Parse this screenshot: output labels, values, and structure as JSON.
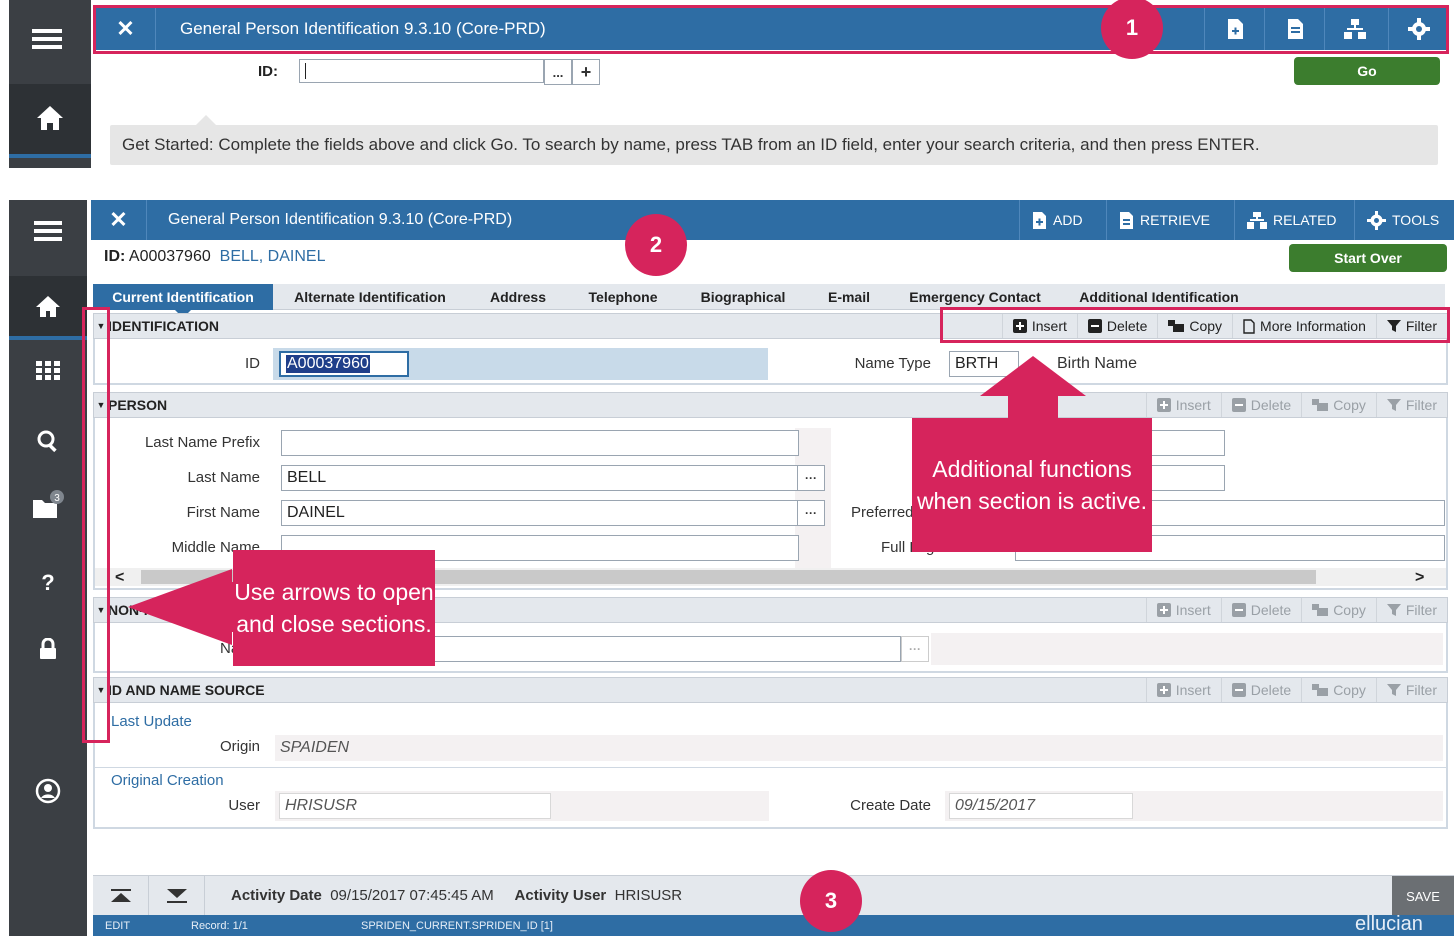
{
  "colors": {
    "nav_bar": "#2e6da4",
    "sidebar": "#3b3f44",
    "accent_annotation": "#d6245c",
    "go_button": "#3c7d2e",
    "link_text": "#2e6da4"
  },
  "screen1": {
    "title": "General Person Identification 9.3.10 (Core-PRD)",
    "close_icon": "✕",
    "toolbar_icons": [
      "add-icon",
      "retrieve-icon",
      "related-icon",
      "tools-icon"
    ],
    "id_label": "ID:",
    "id_value": "",
    "search_button": "...",
    "add_button": "+",
    "go_label": "Go",
    "tip": "Get Started: Complete the fields above and click Go. To search by name, press TAB from an ID field, enter your search criteria, and then press ENTER.",
    "badge": "1"
  },
  "screen2": {
    "title": "General Person Identification 9.3.10 (Core-PRD)",
    "actions": {
      "add": "ADD",
      "retrieve": "RETRIEVE",
      "related": "RELATED",
      "tools": "TOOLS"
    },
    "key_label": "ID:",
    "key_id": "A00037960",
    "key_name": "BELL, DAINEL",
    "start_over": "Start Over",
    "badge": "2",
    "tabs": [
      "Current Identification",
      "Alternate Identification",
      "Address",
      "Telephone",
      "Biographical",
      "E-mail",
      "Emergency Contact",
      "Additional Identification"
    ],
    "section_tools": {
      "insert": "Insert",
      "delete": "Delete",
      "copy": "Copy",
      "more": "More Information",
      "filter": "Filter"
    },
    "identification": {
      "title": "IDENTIFICATION",
      "id_label": "ID",
      "id_value": "A00037960",
      "name_type_label": "Name Type",
      "name_type_code": "BRTH",
      "name_type_desc": "Birth Name"
    },
    "person": {
      "title": "PERSON",
      "last_name_prefix_label": "Last Name Prefix",
      "last_name_label": "Last Name",
      "last_name_value": "BELL",
      "first_name_label": "First Name",
      "first_name_value": "DAINEL",
      "middle_name_label": "Middle Name",
      "preferred_label": "Preferred",
      "full_legal_label": "Full Legal Name"
    },
    "name_section": {
      "title": "NON-PERSON",
      "name_label": "Name"
    },
    "source": {
      "title": "ID AND NAME SOURCE",
      "last_update": "Last Update",
      "origin_label": "Origin",
      "origin_value": "SPAIDEN",
      "original_creation": "Original Creation",
      "user_label": "User",
      "user_value": "HRISUSR",
      "create_date_label": "Create Date",
      "create_date_value": "09/15/2017"
    },
    "activity": {
      "date_label": "Activity Date",
      "date_value": "09/15/2017 07:45:45 AM",
      "user_label": "Activity User",
      "user_value": "HRISUSR",
      "save": "SAVE"
    },
    "status": {
      "mode": "EDIT",
      "record": "Record: 1/1",
      "field": "SPRIDEN_CURRENT.SPRIDEN_ID [1]",
      "brand": "ellucian"
    },
    "badge3": "3",
    "sidebar_badge": "3"
  },
  "callouts": {
    "arrows": "Use arrows to open and close sections.",
    "functions": "Additional functions when section is active."
  }
}
